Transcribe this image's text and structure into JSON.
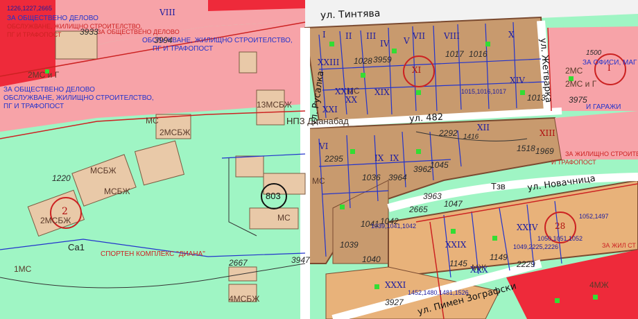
{
  "map": {
    "streets": [
      {
        "text": "ул. Тинтява"
      },
      {
        "text": "ул. Русалка"
      },
      {
        "text": "ул. Жетварка"
      },
      {
        "text": "ул. 482"
      },
      {
        "text": "ул. Новачница"
      },
      {
        "text": "ул. Пимен Зографски"
      }
    ],
    "zone_notes": [
      {
        "text": "ЗА ОБЩЕСТВЕНО ДЕЛОВО"
      },
      {
        "text": "ОБСЛУЖВАНЕ, ЖИЛИЩНО СТРОИТЕЛСТВО,"
      },
      {
        "text": "ПГ И ТРАФОПОСТ"
      },
      {
        "text": "ЗА ОБЩЕСТВЕНО ДЕЛОВО"
      },
      {
        "text": "ОБСЛУЖВАНЕ, ЖИЛИЩНО СТРОИТЕЛСТВО,"
      },
      {
        "text": "ПГ И ТРАФОПОСТ"
      },
      {
        "text": "ЗА ОБЩЕСТВЕНО ДЕЛОВО"
      },
      {
        "text": "ОБСЛУЖВАНЕ, ЖИЛИЩНО СТРОИТЕЛСТВО,"
      },
      {
        "text": "ПГ И ТРАФОПОСТ"
      },
      {
        "text": "ЗА ОФИСИ, МАГ"
      },
      {
        "text": "И ГАРАЖИ"
      },
      {
        "text": "ЗА ЖИЛИЩНО СТРОИТЕЛСТВО"
      },
      {
        "text": "И ТРАФОПОСТ"
      },
      {
        "text": "ЗА ЖИЛ СТ"
      }
    ],
    "place_names": [
      {
        "text": "НПЗ Дианабад"
      },
      {
        "text": "СПОРТЕН КОМПЛЕКС \"ДИАНА\""
      }
    ],
    "circled": [
      {
        "text": "803"
      },
      {
        "text": "2"
      },
      {
        "text": "XI"
      },
      {
        "text": "I"
      },
      {
        "text": "28"
      }
    ],
    "building_labels": [
      {
        "text": "МС"
      },
      {
        "text": "2МС"
      },
      {
        "text": "2МСБЖ"
      },
      {
        "text": "13МСБЖ"
      },
      {
        "text": "МСБЖ"
      },
      {
        "text": "МСБЖ"
      },
      {
        "text": "2МСБЖ"
      },
      {
        "text": "4МСБЖ"
      },
      {
        "text": "1МС"
      },
      {
        "text": "2МС и Г"
      },
      {
        "text": "МС"
      },
      {
        "text": "МС"
      },
      {
        "text": "МЖ"
      },
      {
        "text": "4МЖ"
      },
      {
        "text": "2МС и Г"
      },
      {
        "text": "МС"
      }
    ],
    "parcel_numbers": [
      {
        "text": "3959"
      },
      {
        "text": "1017"
      },
      {
        "text": "1016"
      },
      {
        "text": "1013"
      },
      {
        "text": "1028"
      },
      {
        "text": "1036"
      },
      {
        "text": "3964"
      },
      {
        "text": "3962"
      },
      {
        "text": "1045"
      },
      {
        "text": "2665"
      },
      {
        "text": "3963"
      },
      {
        "text": "1047"
      },
      {
        "text": "1041"
      },
      {
        "text": "1042"
      },
      {
        "text": "1039"
      },
      {
        "text": "1040"
      },
      {
        "text": "3947"
      },
      {
        "text": "2667"
      },
      {
        "text": "1220"
      },
      {
        "text": "2295"
      },
      {
        "text": "2292"
      },
      {
        "text": "1969"
      },
      {
        "text": "1518"
      },
      {
        "text": "1416"
      },
      {
        "text": "1500"
      },
      {
        "text": "3975"
      },
      {
        "text": "3927"
      },
      {
        "text": "3933"
      },
      {
        "text": "3994"
      },
      {
        "text": "1149"
      },
      {
        "text": "1145"
      },
      {
        "text": "2229"
      }
    ],
    "roman_numerals": [
      {
        "text": "I"
      },
      {
        "text": "II"
      },
      {
        "text": "III"
      },
      {
        "text": "IV"
      },
      {
        "text": "V"
      },
      {
        "text": "VI"
      },
      {
        "text": "VII"
      },
      {
        "text": "VIII"
      },
      {
        "text": "IX"
      },
      {
        "text": "X"
      },
      {
        "text": "XII"
      },
      {
        "text": "XIII"
      },
      {
        "text": "XIV"
      },
      {
        "text": "XIX"
      },
      {
        "text": "XX"
      },
      {
        "text": "XXI"
      },
      {
        "text": "XXII"
      },
      {
        "text": "XXIII"
      },
      {
        "text": "XXIV"
      },
      {
        "text": "XXIX"
      },
      {
        "text": "XXX"
      },
      {
        "text": "XXXI"
      },
      {
        "text": "VIII"
      },
      {
        "text": "IX"
      }
    ],
    "zone_codes": [
      {
        "text": "Тзв"
      },
      {
        "text": "Са1"
      }
    ],
    "lot_codes": [
      {
        "text": "1226,1227,2665"
      },
      {
        "text": "1050,1051,1052"
      },
      {
        "text": "1049,2225,2226"
      },
      {
        "text": "1052,1497"
      },
      {
        "text": "1452,1480,1481,1526"
      },
      {
        "text": "1039,1041,1042"
      },
      {
        "text": "1015,1016,1017"
      }
    ],
    "colors": {
      "green_zone": "#9ff5c4",
      "block_fill": "#c89a6e",
      "block_stroke": "#7a4a30",
      "pink_zone": "#f7a3a8",
      "red_zone": "#ee2a3a",
      "road": "#ffffff",
      "blue_line": "#2233cc",
      "red_line": "#cc2222"
    }
  }
}
